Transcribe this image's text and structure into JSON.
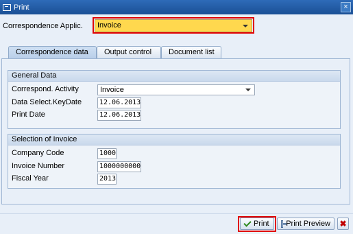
{
  "window": {
    "title": "Print",
    "close_glyph": "×"
  },
  "header": {
    "applic_label": "Correspondence Applic.",
    "applic_value": "Invoice"
  },
  "tabs": [
    {
      "label": "Correspondence data",
      "active": true
    },
    {
      "label": "Output control",
      "active": false
    },
    {
      "label": "Document list",
      "active": false
    }
  ],
  "general": {
    "title": "General Data",
    "activity_label": "Correspond. Activity",
    "activity_value": "Invoice",
    "keydate_label": "Data Select.KeyDate",
    "keydate_value": "12.06.2013",
    "printdate_label": "Print Date",
    "printdate_value": "12.06.2013"
  },
  "selection": {
    "title": "Selection of Invoice",
    "company_label": "Company Code",
    "company_value": "1000",
    "invoice_label": "Invoice Number",
    "invoice_value": "1000000000",
    "year_label": "Fiscal Year",
    "year_value": "2013"
  },
  "footer": {
    "print_label": "Print",
    "preview_label": "Print Preview",
    "cancel_glyph": "✖"
  },
  "icons": {
    "print": "checkmark-icon",
    "preview": "print-preview-icon",
    "cancel": "cancel-icon"
  },
  "colors": {
    "titlebar": "#1a4f95",
    "highlight_field": "#ffd84e",
    "annotation_red": "#e00000"
  }
}
